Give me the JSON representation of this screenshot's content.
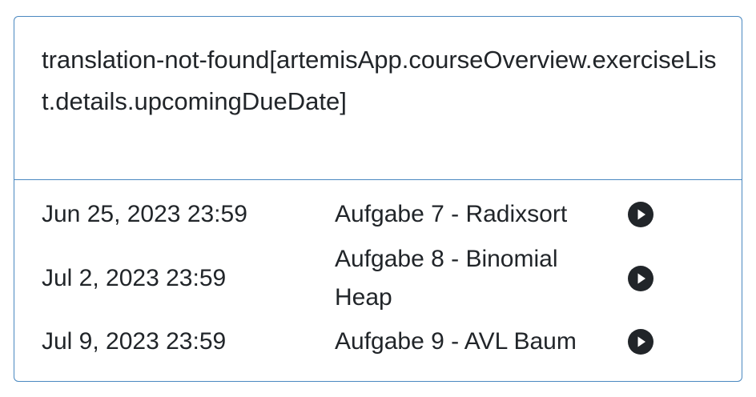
{
  "card": {
    "header_title": "translation-not-found[artemisApp.courseOverview.exerciseList.details.upcomingDueDate]"
  },
  "exercises": [
    {
      "due_date": "Jun 25, 2023 23:59",
      "title": "Aufgabe 7 - Radixsort",
      "icon": "play-circle-icon"
    },
    {
      "due_date": "Jul 2, 2023 23:59",
      "title": "Aufgabe 8 - Binomial Heap",
      "icon": "play-circle-icon"
    },
    {
      "due_date": "Jul 9, 2023 23:59",
      "title": "Aufgabe 9 - AVL Baum",
      "icon": "play-circle-icon"
    }
  ]
}
